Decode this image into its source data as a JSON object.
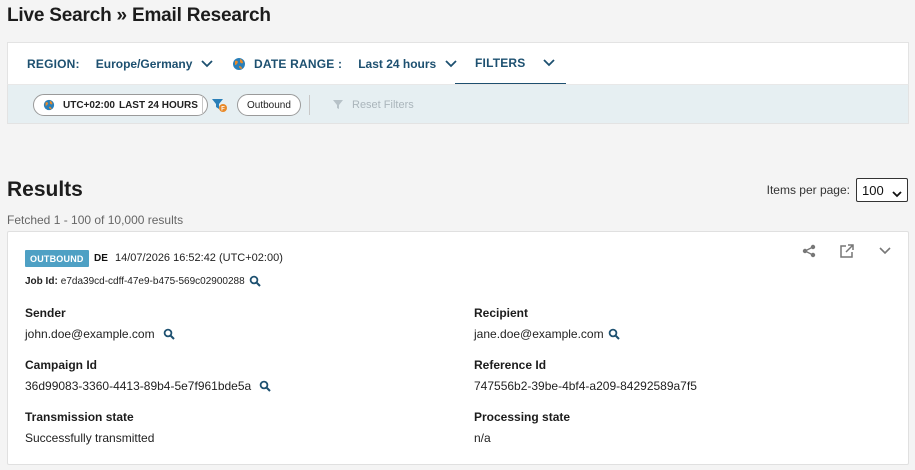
{
  "page": {
    "title": "Live Search » Email Research"
  },
  "filterbar": {
    "region_label": "REGION:",
    "region_value": "Europe/Germany",
    "date_label": "DATE RANGE :",
    "date_value": "Last 24 hours",
    "filters_label": "FILTERS"
  },
  "subbar": {
    "time_pill_tz": "UTC+02:00",
    "time_pill_range": "LAST 24 HOURS",
    "direction_pill": "Outbound",
    "reset_label": "Reset Filters"
  },
  "results": {
    "title": "Results",
    "items_per_page_label": "Items per page:",
    "items_per_page_value": "100",
    "fetched_text": "Fetched 1 - 100 of 10,000 results"
  },
  "card": {
    "badge": "OUTBOUND",
    "country": "DE",
    "timestamp": "14/07/2026 16:52:42 (UTC+02:00)",
    "job_id_label": "Job Id:",
    "job_id": "e7da39cd-cdff-47e9-b475-569c02900288",
    "fields": {
      "sender_label": "Sender",
      "sender_value": "john.doe@example.com",
      "recipient_label": "Recipient",
      "recipient_value": "jane.doe@example.com",
      "campaign_label": "Campaign Id",
      "campaign_value": "36d99083-3360-4413-89b4-5e7f961bde5a",
      "reference_label": "Reference Id",
      "reference_value": "747556b2-39be-4bf4-a209-84292589a7f5",
      "transmission_label": "Transmission state",
      "transmission_value": "Successfully transmitted",
      "processing_label": "Processing state",
      "processing_value": "n/a"
    }
  },
  "colors": {
    "accent": "#1d5070",
    "badge": "#4ea0c4",
    "subbar_bg": "#e6eff2",
    "globe_orange": "#e88a2b",
    "globe_blue": "#2a7fb8"
  },
  "icons": {
    "region_chevron": "chevron-down-icon",
    "date_globe": "globe-icon",
    "filter": "filter-icon",
    "search": "magnifier-icon",
    "share": "share-icon",
    "open": "external-link-icon",
    "expand": "chevron-down-icon"
  }
}
